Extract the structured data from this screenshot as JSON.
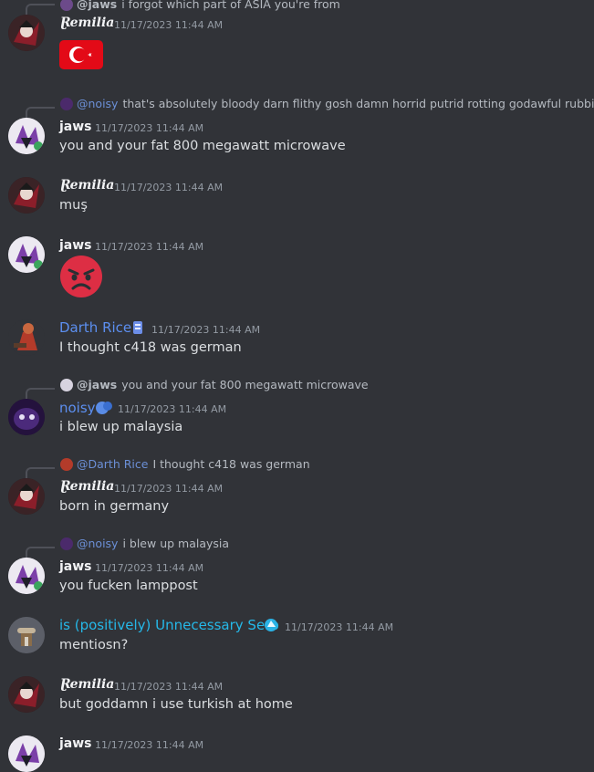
{
  "messages": [
    {
      "reply": {
        "mention": "@jaws",
        "text": "i forgot which part of ASIA you're from"
      },
      "author": "Ɽemilia",
      "timestamp": "11/17/2023 11:44 AM",
      "content": "",
      "flag_icon": "turkey-flag"
    },
    {
      "reply": {
        "mention": "@noisy",
        "text": "that's absolutely bloody darn flithy gosh damn horrid putrid rotting godawful rubbish"
      },
      "author": "jaws",
      "timestamp": "11/17/2023 11:44 AM",
      "content": "you and your fat 800 megawatt microwave"
    },
    {
      "author": "Ɽemilia",
      "timestamp": "11/17/2023 11:44 AM",
      "content": "muş"
    },
    {
      "author": "jaws",
      "timestamp": "11/17/2023 11:44 AM",
      "content": "",
      "emoji_icon": "angry-face"
    },
    {
      "author": "Darth Rice",
      "timestamp": "11/17/2023 11:44 AM",
      "content": "I thought c418 was german"
    },
    {
      "reply": {
        "mention": "@jaws",
        "text": "you and your fat 800 megawatt microwave"
      },
      "author": "noisy",
      "timestamp": "11/17/2023 11:44 AM",
      "content": "i blew up malaysia"
    },
    {
      "reply": {
        "mention": "@Darth Rice",
        "text": "I thought c418 was german"
      },
      "author": "Ɽemilia",
      "timestamp": "11/17/2023 11:44 AM",
      "content": "born in germany"
    },
    {
      "reply": {
        "mention": "@noisy",
        "text": "i blew up malaysia"
      },
      "author": "jaws",
      "timestamp": "11/17/2023 11:44 AM",
      "content": "you fucken lamppost"
    },
    {
      "author": "is (positively) Unnecessary Serb",
      "timestamp": "11/17/2023 11:44 AM",
      "content": "mentiosn?"
    },
    {
      "author": "Ɽemilia",
      "timestamp": "11/17/2023 11:44 AM",
      "content": "but goddamn i use turkish at home"
    },
    {
      "author": "jaws",
      "timestamp": "11/17/2023 11:44 AM",
      "content": ""
    }
  ],
  "colors": {
    "background": "#313338",
    "link_blue": "#5c8ff0",
    "cyan": "#25b8e8",
    "timestamp": "#949ba4"
  }
}
